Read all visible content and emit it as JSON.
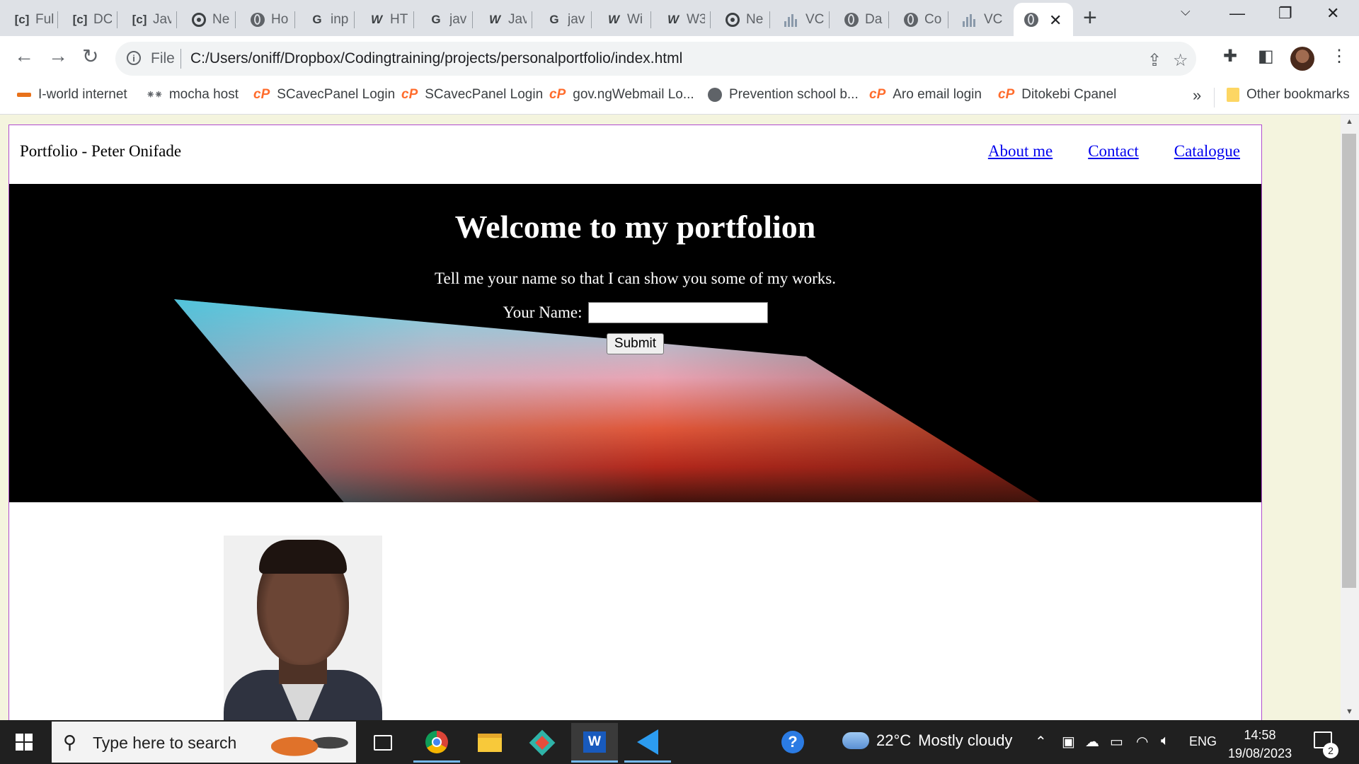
{
  "browser": {
    "tabs": [
      {
        "label": "Ful",
        "icon": "codepen-icon"
      },
      {
        "label": "DC",
        "icon": "codepen-icon"
      },
      {
        "label": "Jav",
        "icon": "codepen-icon"
      },
      {
        "label": "Ne",
        "icon": "chrome-icon"
      },
      {
        "label": "Ho",
        "icon": "globe-icon"
      },
      {
        "label": "inp",
        "icon": "google-icon"
      },
      {
        "label": "HT",
        "icon": "w3schools-icon"
      },
      {
        "label": "jav",
        "icon": "google-icon"
      },
      {
        "label": "Jav",
        "icon": "w3schools-icon"
      },
      {
        "label": "jav",
        "icon": "google-icon"
      },
      {
        "label": "Wi",
        "icon": "w3schools-icon"
      },
      {
        "label": "W3",
        "icon": "w3schools-icon"
      },
      {
        "label": "Ne",
        "icon": "chrome-icon"
      },
      {
        "label": "VC",
        "icon": "chart-icon"
      },
      {
        "label": "Da",
        "icon": "globe-icon"
      },
      {
        "label": "Co",
        "icon": "globe-icon"
      },
      {
        "label": "VC",
        "icon": "chart-icon"
      }
    ],
    "omnibox": {
      "scheme_label": "File",
      "url": "C:/Users/oniff/Dropbox/Codingtraining/projects/personalportfolio/index.html"
    },
    "bookmarks": [
      {
        "label": "I-world internet"
      },
      {
        "label": "mocha host"
      },
      {
        "label": "SCavecPanel Login"
      },
      {
        "label": "SCavecPanel Login"
      },
      {
        "label": "gov.ngWebmail Lo..."
      },
      {
        "label": "Prevention school b..."
      },
      {
        "label": "Aro email login"
      },
      {
        "label": "Ditokebi Cpanel"
      }
    ],
    "bookmarks_more": "»",
    "other_bookmarks": "Other bookmarks"
  },
  "site": {
    "brand": "Portfolio - Peter Onifade",
    "nav": [
      "About me",
      "Contact",
      "Catalogue"
    ],
    "hero_title": "Welcome to my portfolion",
    "hero_subtitle": "Tell me your name so that I can show you some of my works.",
    "name_label": "Your Name:",
    "name_value": "",
    "submit_label": "Submit"
  },
  "taskbar": {
    "search_placeholder": "Type here to search",
    "weather_temp": "22°C",
    "weather_desc": "Mostly cloudy",
    "language": "ENG",
    "time": "14:58",
    "date": "19/08/2023",
    "notification_count": "2"
  }
}
